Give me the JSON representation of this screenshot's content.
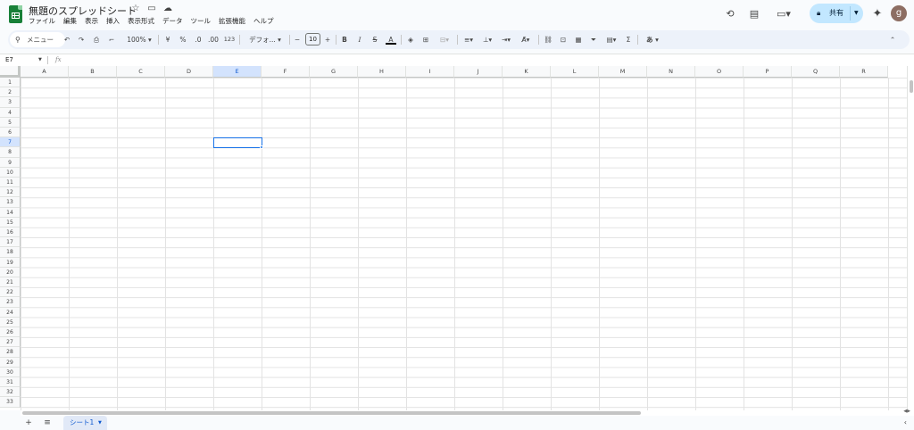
{
  "app": {
    "title": "無題のスプレッドシート",
    "accent": "#188038",
    "menus": [
      "ファイル",
      "編集",
      "表示",
      "挿入",
      "表示形式",
      "データ",
      "ツール",
      "拡張機能",
      "ヘルプ"
    ],
    "share_label": "共有",
    "avatar_letter": "g"
  },
  "toolbar": {
    "search": "メニュー",
    "zoom": "100%",
    "currency": "¥",
    "percent": "%",
    "dec_decrease": ".0",
    "dec_increase": ".00",
    "format_123": "123",
    "font": "デフォ...",
    "font_size": "10",
    "bold": "B",
    "italic": "I",
    "strike": "S",
    "text_color": "A",
    "sum": "Σ",
    "input_tool": "あ"
  },
  "formula_bar": {
    "cell_ref": "E7",
    "fx": "fx"
  },
  "grid": {
    "columns": [
      "A",
      "B",
      "C",
      "D",
      "E",
      "F",
      "G",
      "H",
      "I",
      "J",
      "K",
      "L",
      "M",
      "N",
      "O",
      "P",
      "Q",
      "R"
    ],
    "rows": [
      "1",
      "2",
      "3",
      "4",
      "5",
      "6",
      "7",
      "8",
      "9",
      "10",
      "11",
      "12",
      "13",
      "14",
      "15",
      "16",
      "17",
      "18",
      "19",
      "20",
      "21",
      "22",
      "23",
      "24",
      "25",
      "26",
      "27",
      "28",
      "29",
      "30",
      "31",
      "32",
      "33"
    ],
    "selected_column": "E",
    "selected_row": "7",
    "selection_color": "#1a73e8"
  },
  "sheets": {
    "tabs": [
      "シート1"
    ],
    "active": "シート1"
  }
}
